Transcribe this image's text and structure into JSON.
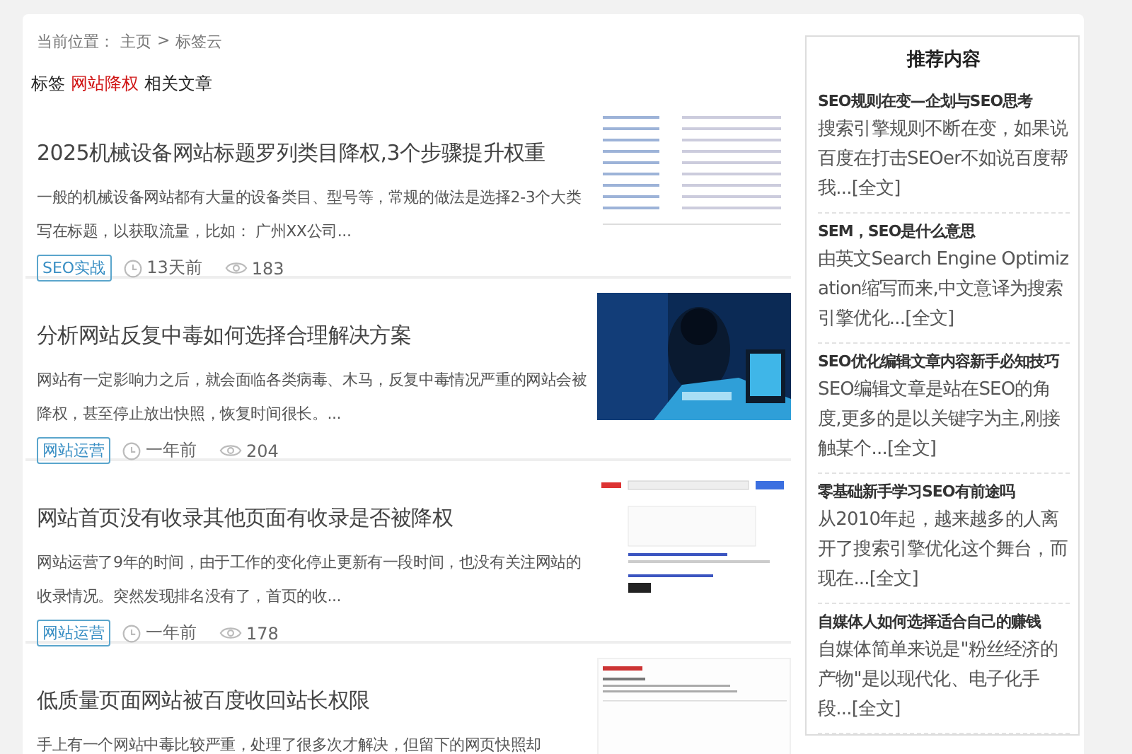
{
  "breadcrumb": {
    "label": "当前位置：",
    "items": [
      "主页",
      "标签云"
    ],
    "separator": ">"
  },
  "tag_heading": {
    "prefix": "标签",
    "tag": "网站降权",
    "suffix": "相关文章"
  },
  "articles": [
    {
      "title": "2025机械设备网站标题罗列类目降权,3个步骤提升权重",
      "excerpt": "一般的机械设备网站都有大量的设备类目、型号等，常规的做法是选择2-3个大类写在标题，以获取流量，比如： 广州XX公司...",
      "category": "SEO实战",
      "time": "13天前",
      "views": "183"
    },
    {
      "title": "分析网站反复中毒如何选择合理解决方案",
      "excerpt": "网站有一定影响力之后，就会面临各类病毒、木马，反复中毒情况严重的网站会被降权，甚至停止放出快照，恢复时间很长。...",
      "category": "网站运营",
      "time": "一年前",
      "views": "204"
    },
    {
      "title": "网站首页没有收录其他页面有收录是否被降权",
      "excerpt": "网站运营了9年的时间，由于工作的变化停止更新有一段时间，也没有关注网站的收录情况。突然发现排名没有了，首页的收...",
      "category": "网站运营",
      "time": "一年前",
      "views": "178"
    },
    {
      "title": "低质量页面网站被百度收回站长权限",
      "excerpt": "手上有一个网站中毒比较严重，处理了很多次才解决，但留下的网页快照却"
    }
  ],
  "sidebar": {
    "title": "推荐内容",
    "items": [
      {
        "title": "SEO规则在变—企划与SEO思考",
        "excerpt": "搜索引擎规则不断在变，如果说百度在打击SEOer不如说百度帮我...",
        "more": "[全文]"
      },
      {
        "title": "SEM，SEO是什么意思",
        "excerpt": "由英文Search Engine Optimization缩写而来,中文意译为搜索引擎优化...",
        "more": "[全文]"
      },
      {
        "title": "SEO优化编辑文章内容新手必知技巧",
        "excerpt": "SEO编辑文章是站在SEO的角度,更多的是以关键字为主,刚接触某个...",
        "more": "[全文]"
      },
      {
        "title": "零基础新手学习SEO有前途吗",
        "excerpt": "从2010年起，越来越多的人离开了搜索引擎优化这个舞台，而现在...",
        "more": "[全文]"
      },
      {
        "title": "自媒体人如何选择适合自己的赚钱",
        "excerpt": "自媒体简单来说是\"粉丝经济的产物\"是以现代化、电子化手段...",
        "more": "[全文]"
      }
    ]
  }
}
